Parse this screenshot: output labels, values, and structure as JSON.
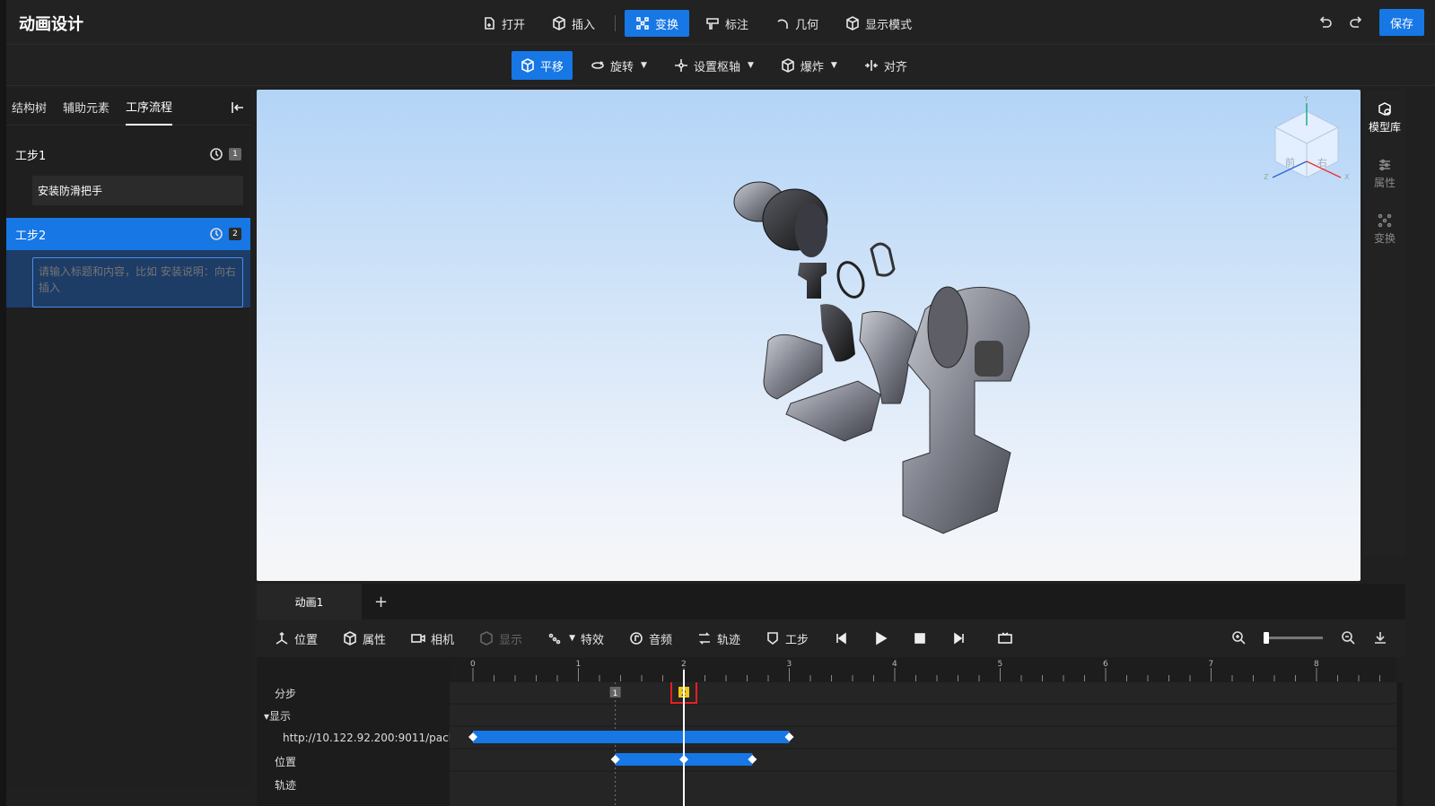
{
  "app": {
    "title": "动画设计"
  },
  "menu": {
    "items": [
      {
        "label": "打开",
        "icon": "file-open-icon"
      },
      {
        "label": "插入",
        "icon": "cube-icon"
      },
      {
        "label": "变换",
        "icon": "transform-icon",
        "active": true
      },
      {
        "label": "标注",
        "icon": "annotate-icon"
      },
      {
        "label": "几何",
        "icon": "arc-icon"
      },
      {
        "label": "显示模式",
        "icon": "display-mode-icon"
      }
    ],
    "save_label": "保存"
  },
  "submenu": {
    "items": [
      {
        "label": "平移",
        "active": true
      },
      {
        "label": "旋转",
        "dropdown": true
      },
      {
        "label": "设置枢轴",
        "dropdown": true
      },
      {
        "label": "爆炸",
        "dropdown": true
      },
      {
        "label": "对齐"
      }
    ]
  },
  "left_panel": {
    "tabs": [
      "结构树",
      "辅助元素",
      "工序流程"
    ],
    "active_tab": "工序流程",
    "steps": [
      {
        "title": "工步1",
        "badge": "1",
        "item": "安装防滑把手"
      },
      {
        "title": "工步2",
        "badge": "2",
        "placeholder": "请输入标题和内容，比如 安装说明：向右插入"
      }
    ]
  },
  "right_panel": {
    "items": [
      "模型库",
      "属性",
      "变换"
    ]
  },
  "view_cube": {
    "labels": [
      "Y",
      "X",
      "Z",
      "前",
      "右"
    ]
  },
  "timeline": {
    "tab": "动画1",
    "add": "+",
    "toolbar": [
      "位置",
      "属性",
      "相机",
      "显示",
      "特效",
      "音频",
      "轨迹",
      "工步"
    ],
    "ruler_ticks": [
      "0",
      "1",
      "2",
      "3",
      "4",
      "5",
      "6",
      "7",
      "8"
    ],
    "tracks": [
      {
        "label": "分步"
      },
      {
        "label": "▾显示"
      },
      {
        "label": "http://10.122.92.200:9011/pack..."
      },
      {
        "label": "位置"
      },
      {
        "label": "轨迹"
      }
    ],
    "step_markers": [
      "1",
      "2"
    ],
    "playhead_time": 2.0,
    "bars": [
      {
        "row": 2,
        "start": 0.0,
        "end": 3.0,
        "keys": [
          0.0,
          3.0
        ]
      },
      {
        "row": 3,
        "start": 1.35,
        "end": 2.65,
        "keys": [
          1.35,
          2.0,
          2.65
        ]
      }
    ]
  }
}
